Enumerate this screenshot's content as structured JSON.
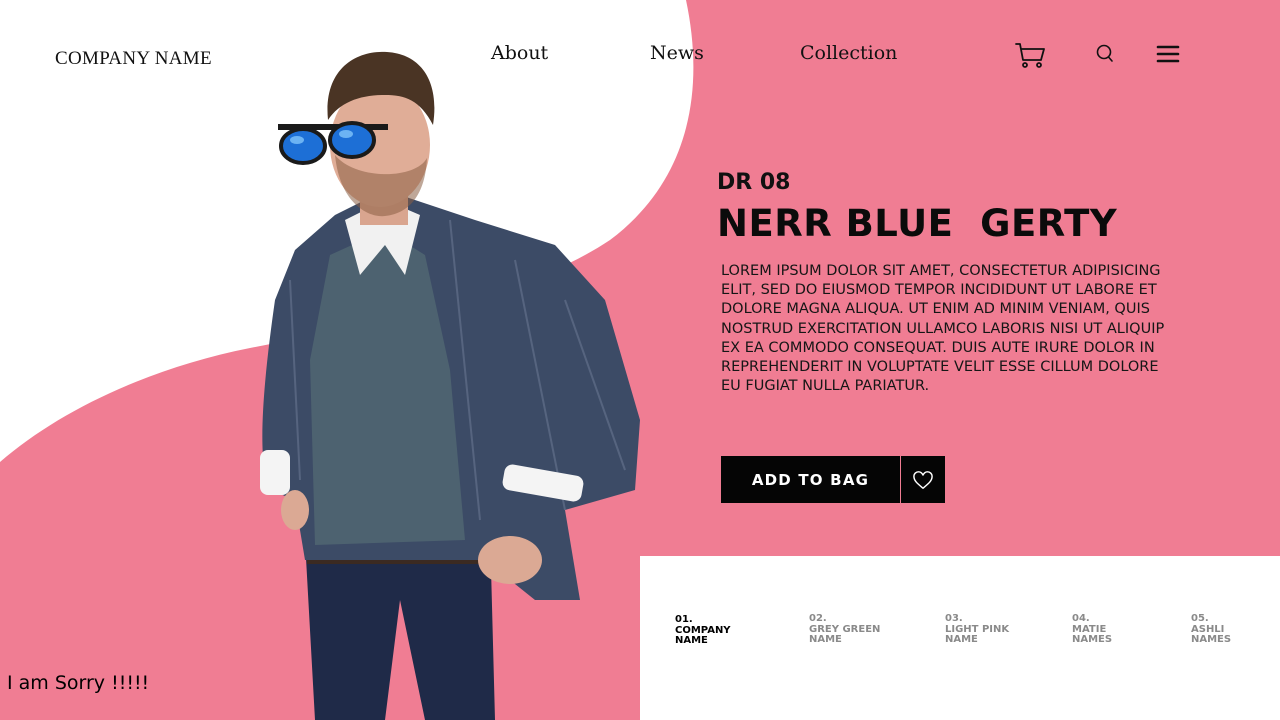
{
  "header": {
    "brand": "COMPANY NAME",
    "nav": [
      {
        "label": "About"
      },
      {
        "label": "News"
      },
      {
        "label": "Collection"
      }
    ],
    "icons": [
      "cart-icon",
      "search-icon",
      "menu-icon"
    ]
  },
  "product": {
    "code": "DR 08",
    "name": "NERR BLUE  GERTY",
    "description": "LOREM IPSUM DOLOR SIT AMET, CONSECTETUR ADIPISICING ELIT, SED DO EIUSMOD TEMPOR INCIDIDUNT UT LABORE ET DOLORE MAGNA ALIQUA. UT ENIM AD MINIM VENIAM, QUIS NOSTRUD EXERCITATION ULLAMCO LABORIS NISI UT ALIQUIP EX EA COMMODO CONSEQUAT. DUIS AUTE IRURE DOLOR IN REPREHENDERIT IN VOLUPTATE VELIT ESSE CILLUM DOLORE EU FUGIAT NULLA PARIATUR.",
    "add_to_bag_label": "ADD TO BAG",
    "favorite_icon": "heart-icon"
  },
  "variants": [
    {
      "number": "01.",
      "name": "COMPANY\nNAME",
      "active": true
    },
    {
      "number": "02.",
      "name": "GREY GREEN\nNAME",
      "active": false
    },
    {
      "number": "03.",
      "name": "LIGHT PINK\nNAME",
      "active": false
    },
    {
      "number": "04.",
      "name": "MATIE\nNAMES",
      "active": false
    },
    {
      "number": "05.",
      "name": "ASHLI\nNAMES",
      "active": false
    }
  ],
  "caption": "I am Sorry !!!!!",
  "colors": {
    "accent_pink": "#f07d93",
    "button_black": "#050505",
    "background_white": "#ffffff"
  }
}
